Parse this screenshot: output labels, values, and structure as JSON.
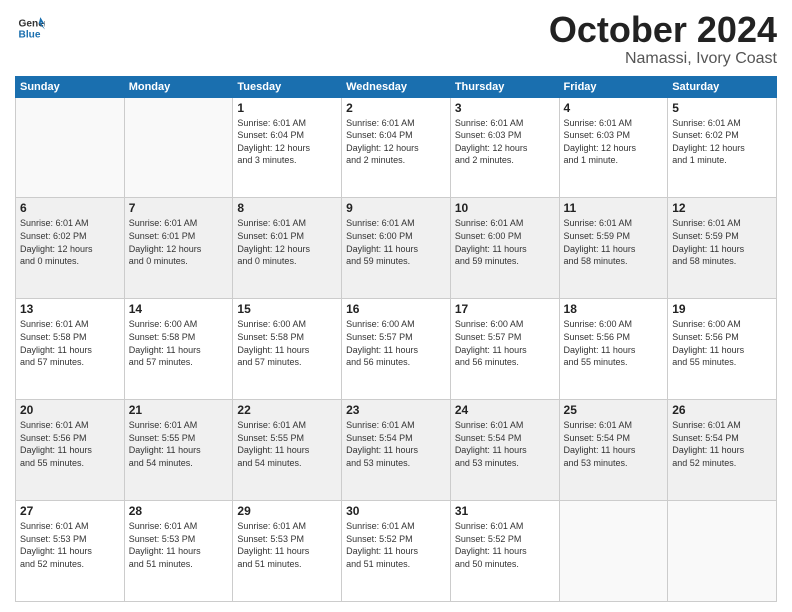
{
  "header": {
    "logo_line1": "General",
    "logo_line2": "Blue",
    "month": "October 2024",
    "location": "Namassi, Ivory Coast"
  },
  "weekdays": [
    "Sunday",
    "Monday",
    "Tuesday",
    "Wednesday",
    "Thursday",
    "Friday",
    "Saturday"
  ],
  "weeks": [
    {
      "shaded": false,
      "days": [
        {
          "num": "",
          "info": ""
        },
        {
          "num": "",
          "info": ""
        },
        {
          "num": "1",
          "info": "Sunrise: 6:01 AM\nSunset: 6:04 PM\nDaylight: 12 hours\nand 3 minutes."
        },
        {
          "num": "2",
          "info": "Sunrise: 6:01 AM\nSunset: 6:04 PM\nDaylight: 12 hours\nand 2 minutes."
        },
        {
          "num": "3",
          "info": "Sunrise: 6:01 AM\nSunset: 6:03 PM\nDaylight: 12 hours\nand 2 minutes."
        },
        {
          "num": "4",
          "info": "Sunrise: 6:01 AM\nSunset: 6:03 PM\nDaylight: 12 hours\nand 1 minute."
        },
        {
          "num": "5",
          "info": "Sunrise: 6:01 AM\nSunset: 6:02 PM\nDaylight: 12 hours\nand 1 minute."
        }
      ]
    },
    {
      "shaded": true,
      "days": [
        {
          "num": "6",
          "info": "Sunrise: 6:01 AM\nSunset: 6:02 PM\nDaylight: 12 hours\nand 0 minutes."
        },
        {
          "num": "7",
          "info": "Sunrise: 6:01 AM\nSunset: 6:01 PM\nDaylight: 12 hours\nand 0 minutes."
        },
        {
          "num": "8",
          "info": "Sunrise: 6:01 AM\nSunset: 6:01 PM\nDaylight: 12 hours\nand 0 minutes."
        },
        {
          "num": "9",
          "info": "Sunrise: 6:01 AM\nSunset: 6:00 PM\nDaylight: 11 hours\nand 59 minutes."
        },
        {
          "num": "10",
          "info": "Sunrise: 6:01 AM\nSunset: 6:00 PM\nDaylight: 11 hours\nand 59 minutes."
        },
        {
          "num": "11",
          "info": "Sunrise: 6:01 AM\nSunset: 5:59 PM\nDaylight: 11 hours\nand 58 minutes."
        },
        {
          "num": "12",
          "info": "Sunrise: 6:01 AM\nSunset: 5:59 PM\nDaylight: 11 hours\nand 58 minutes."
        }
      ]
    },
    {
      "shaded": false,
      "days": [
        {
          "num": "13",
          "info": "Sunrise: 6:01 AM\nSunset: 5:58 PM\nDaylight: 11 hours\nand 57 minutes."
        },
        {
          "num": "14",
          "info": "Sunrise: 6:00 AM\nSunset: 5:58 PM\nDaylight: 11 hours\nand 57 minutes."
        },
        {
          "num": "15",
          "info": "Sunrise: 6:00 AM\nSunset: 5:58 PM\nDaylight: 11 hours\nand 57 minutes."
        },
        {
          "num": "16",
          "info": "Sunrise: 6:00 AM\nSunset: 5:57 PM\nDaylight: 11 hours\nand 56 minutes."
        },
        {
          "num": "17",
          "info": "Sunrise: 6:00 AM\nSunset: 5:57 PM\nDaylight: 11 hours\nand 56 minutes."
        },
        {
          "num": "18",
          "info": "Sunrise: 6:00 AM\nSunset: 5:56 PM\nDaylight: 11 hours\nand 55 minutes."
        },
        {
          "num": "19",
          "info": "Sunrise: 6:00 AM\nSunset: 5:56 PM\nDaylight: 11 hours\nand 55 minutes."
        }
      ]
    },
    {
      "shaded": true,
      "days": [
        {
          "num": "20",
          "info": "Sunrise: 6:01 AM\nSunset: 5:56 PM\nDaylight: 11 hours\nand 55 minutes."
        },
        {
          "num": "21",
          "info": "Sunrise: 6:01 AM\nSunset: 5:55 PM\nDaylight: 11 hours\nand 54 minutes."
        },
        {
          "num": "22",
          "info": "Sunrise: 6:01 AM\nSunset: 5:55 PM\nDaylight: 11 hours\nand 54 minutes."
        },
        {
          "num": "23",
          "info": "Sunrise: 6:01 AM\nSunset: 5:54 PM\nDaylight: 11 hours\nand 53 minutes."
        },
        {
          "num": "24",
          "info": "Sunrise: 6:01 AM\nSunset: 5:54 PM\nDaylight: 11 hours\nand 53 minutes."
        },
        {
          "num": "25",
          "info": "Sunrise: 6:01 AM\nSunset: 5:54 PM\nDaylight: 11 hours\nand 53 minutes."
        },
        {
          "num": "26",
          "info": "Sunrise: 6:01 AM\nSunset: 5:54 PM\nDaylight: 11 hours\nand 52 minutes."
        }
      ]
    },
    {
      "shaded": false,
      "days": [
        {
          "num": "27",
          "info": "Sunrise: 6:01 AM\nSunset: 5:53 PM\nDaylight: 11 hours\nand 52 minutes."
        },
        {
          "num": "28",
          "info": "Sunrise: 6:01 AM\nSunset: 5:53 PM\nDaylight: 11 hours\nand 51 minutes."
        },
        {
          "num": "29",
          "info": "Sunrise: 6:01 AM\nSunset: 5:53 PM\nDaylight: 11 hours\nand 51 minutes."
        },
        {
          "num": "30",
          "info": "Sunrise: 6:01 AM\nSunset: 5:52 PM\nDaylight: 11 hours\nand 51 minutes."
        },
        {
          "num": "31",
          "info": "Sunrise: 6:01 AM\nSunset: 5:52 PM\nDaylight: 11 hours\nand 50 minutes."
        },
        {
          "num": "",
          "info": ""
        },
        {
          "num": "",
          "info": ""
        }
      ]
    }
  ]
}
